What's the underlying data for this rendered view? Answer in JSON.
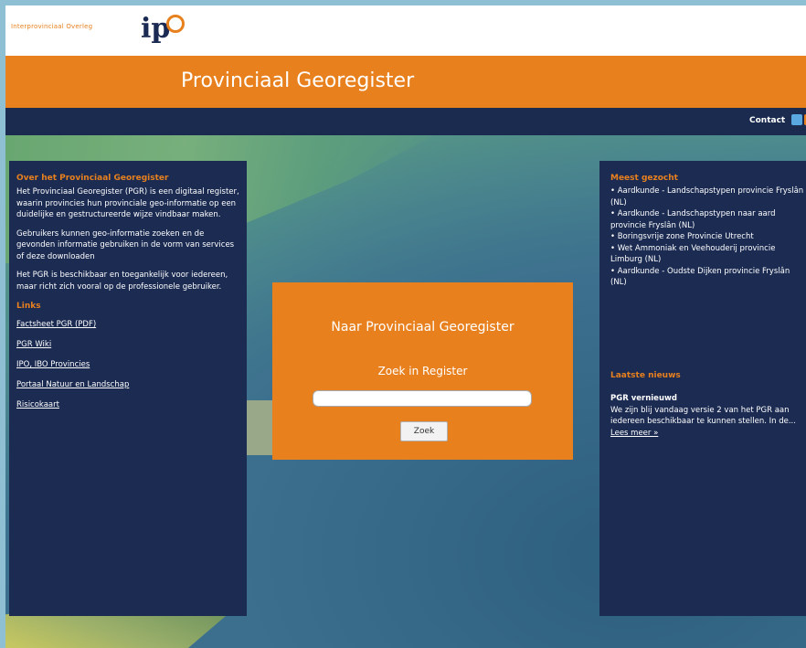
{
  "header": {
    "logo_small_text": "Interprovinciaal Overleg",
    "logo_text": "ip"
  },
  "banner": {
    "title": "Provinciaal Georegister"
  },
  "nav": {
    "contact": "Contact",
    "separator": "|"
  },
  "left_panel": {
    "heading": "Over het Provinciaal Georegister",
    "paragraphs": [
      "Het Provinciaal Georegister (PGR) is een digitaal register, waarin provincies hun provinciale geo-informatie op een duidelijke en gestructureerde wijze vindbaar maken.",
      "Gebruikers kunnen geo-informatie zoeken en de gevonden informatie gebruiken in de vorm van services of deze downloaden",
      "Het PGR is beschikbaar en toegankelijk voor iedereen, maar richt zich vooral op de professionele gebruiker."
    ],
    "links_heading": "Links",
    "links": [
      "Factsheet PGR (PDF)",
      "PGR Wiki",
      "IPO, IBO Provincies",
      "Portaal Natuur en Landschap",
      "Risicokaart"
    ]
  },
  "center": {
    "title": "Naar Provinciaal Georegister",
    "search_label": "Zoek in Register",
    "search_value": "",
    "button_label": "Zoek"
  },
  "right_panel": {
    "heading": "Meest gezocht",
    "items": [
      "• Aardkunde - Landschapstypen provincie Fryslân (NL)",
      "• Aardkunde - Landschapstypen naar aard provincie Fryslân (NL)",
      "• Boringsvrije zone Provincie Utrecht",
      "• Wet Ammoniak en Veehouderij provincie Limburg (NL)",
      "• Aardkunde - Oudste Dijken provincie Fryslân (NL)"
    ],
    "news_heading": "Laatste nieuws",
    "news_title": "PGR vernieuwd",
    "news_text": "We zijn blij vandaag versie 2 van het PGR aan iedereen beschikbaar te kunnen stellen. In de...",
    "news_more": "Lees meer »"
  },
  "colors": {
    "accent": "#e8801e",
    "navy": "#1b2b52"
  }
}
